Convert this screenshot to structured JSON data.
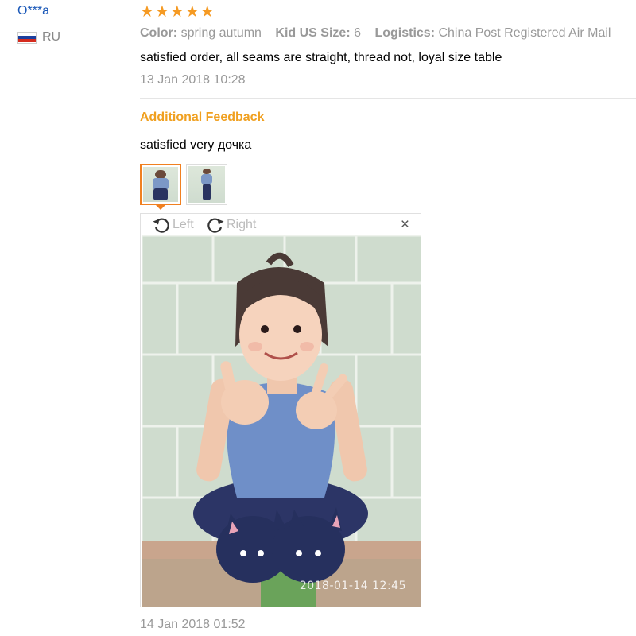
{
  "reviewer": {
    "name": "O***a",
    "country": "RU"
  },
  "rating": {
    "stars": 5
  },
  "order": {
    "props": [
      {
        "key": "Color:",
        "value": "spring autumn"
      },
      {
        "key": "Kid US Size:",
        "value": "6"
      },
      {
        "key": "Logistics:",
        "value": "China Post Registered Air Mail"
      }
    ]
  },
  "review": {
    "text": "satisfied order, all seams are straight, thread not, loyal size table",
    "date": "13 Jan 2018 10:28"
  },
  "additional": {
    "title": "Additional Feedback",
    "text": "satisfied very дочка",
    "date": "14 Jan 2018 01:52"
  },
  "viewer": {
    "rotate_left": "Left",
    "rotate_right": "Right",
    "close": "×",
    "photo_stamp": "2018-01-14 12:45"
  },
  "colors": {
    "name_blue": "#1a58b8",
    "star_orange": "#f59a23",
    "feedback_orange": "#f0a020",
    "muted_gray": "#999999"
  },
  "icons": {
    "rating": "star-icon",
    "rotate_left": "rotate-left-icon",
    "rotate_right": "rotate-right-icon",
    "close": "close-icon",
    "flag": "russia-flag-icon"
  }
}
